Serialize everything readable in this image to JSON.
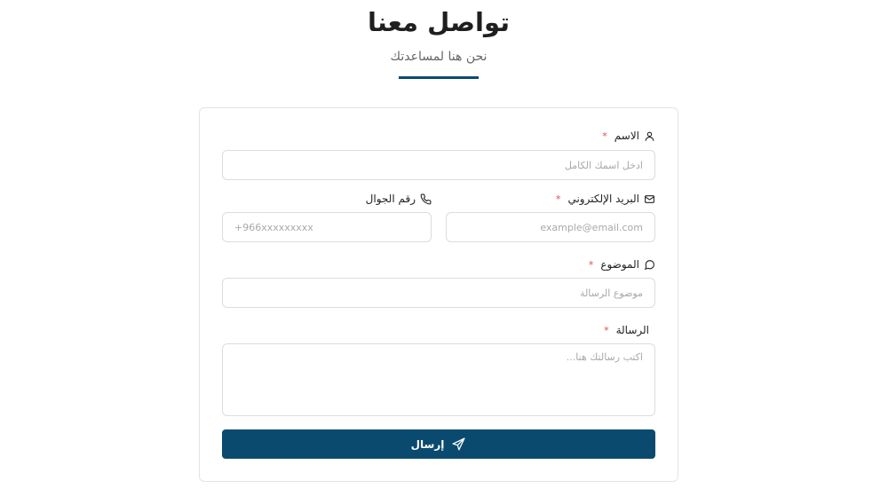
{
  "header": {
    "title": "تواصل معنا",
    "subtitle": "نحن هنا لمساعدتك"
  },
  "form": {
    "required_mark": "*",
    "name": {
      "label": "الاسم",
      "placeholder": "ادخل اسمك الكامل",
      "icon": "user-icon"
    },
    "email": {
      "label": "البريد الإلكتروني",
      "placeholder": "example@email.com",
      "icon": "envelope-icon"
    },
    "phone": {
      "label": "رقم الجوال",
      "placeholder": "+966xxxxxxxxx",
      "icon": "phone-icon"
    },
    "subject": {
      "label": "الموضوع",
      "placeholder": "موضوع الرسالة",
      "icon": "speech-bubble-icon"
    },
    "message": {
      "label": "الرسالة",
      "placeholder": "اكتب رسالتك هنا..."
    },
    "submit": {
      "label": "إرسال",
      "icon": "paper-plane-icon"
    }
  },
  "colors": {
    "primary": "#0b4a6f",
    "required": "#e5484d",
    "border": "#dcdcdc"
  }
}
